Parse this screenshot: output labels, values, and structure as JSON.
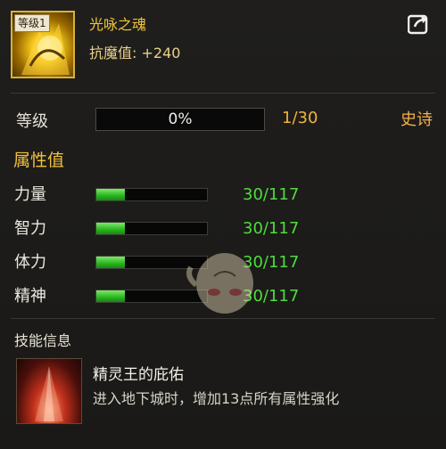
{
  "item": {
    "tag": "等级1",
    "name": "光咏之魂",
    "stat_line": "抗魔值: +240",
    "icon": "golden-spirit-icon"
  },
  "header": {
    "share_icon": "share-export-icon"
  },
  "level": {
    "label": "等级",
    "percent_text": "0%",
    "percent_value": 0,
    "count": "1/30",
    "rarity": "史诗"
  },
  "attributes": {
    "title": "属性值",
    "rows": [
      {
        "name": "力量",
        "value": "30/117",
        "fraction": 0.256
      },
      {
        "name": "智力",
        "value": "30/117",
        "fraction": 0.256
      },
      {
        "name": "体力",
        "value": "30/117",
        "fraction": 0.256
      },
      {
        "name": "精神",
        "value": "30/117",
        "fraction": 0.256
      }
    ]
  },
  "skill": {
    "section_title": "技能信息",
    "name": "精灵王的庇佑",
    "description": "进入地下城时，增加13点所有属性强化",
    "icon": "red-light-skill-icon"
  },
  "colors": {
    "gold": "#f0c63b",
    "green": "#4fdc3e",
    "epic": "#f2b24a"
  }
}
